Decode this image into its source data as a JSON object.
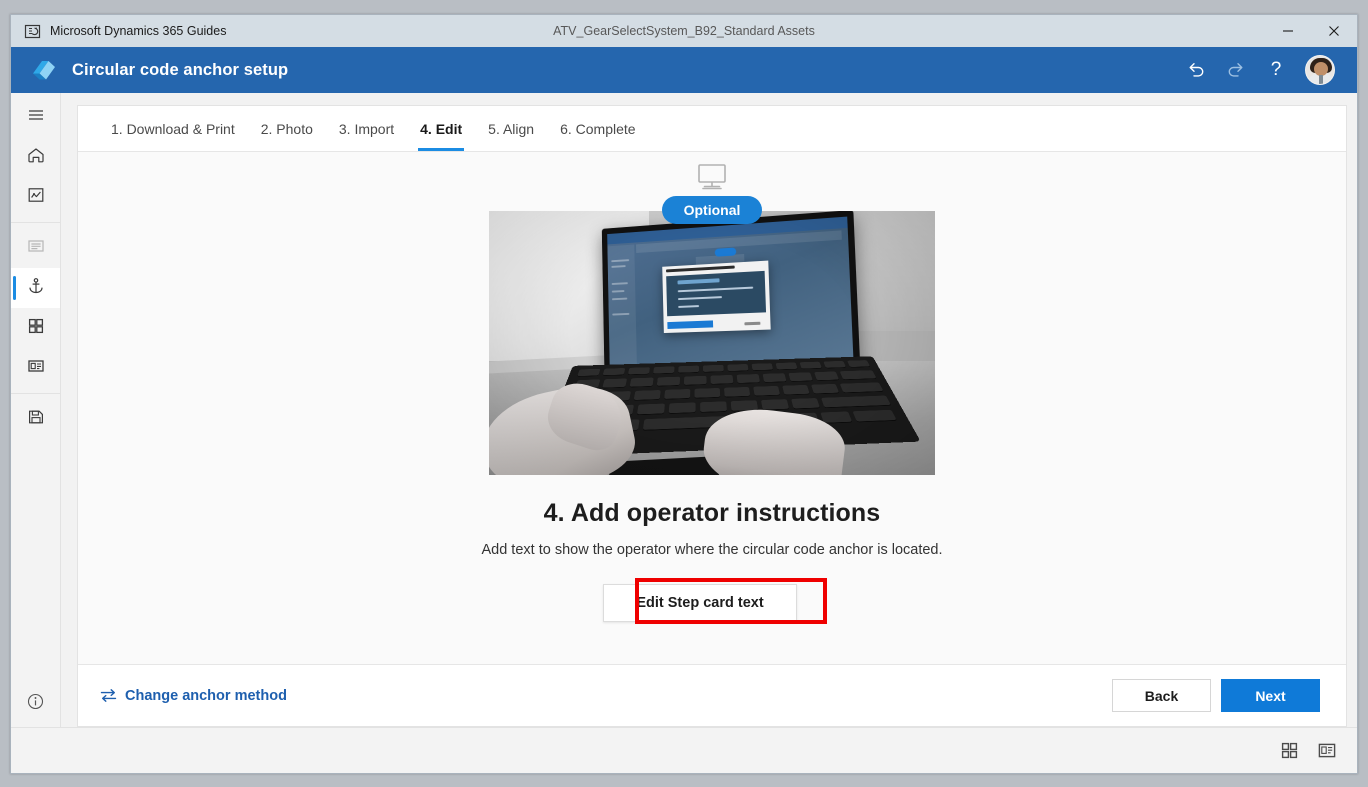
{
  "titlebar": {
    "app_icon": "dynamics-guides-icon",
    "app_name": "Microsoft Dynamics 365 Guides",
    "document_name": "ATV_GearSelectSystem_B92_Standard Assets",
    "minimize_label": "Minimize",
    "close_label": "Close"
  },
  "header": {
    "logo": "guides-cube-logo",
    "title": "Circular code anchor setup",
    "undo_label": "Undo",
    "redo_label": "Redo",
    "help_label": "?",
    "avatar_label": "User account",
    "accent_color": "#2566ae"
  },
  "sidebar": {
    "items": [
      {
        "name": "menu",
        "icon": "hamburger-menu-icon",
        "state": "normal"
      },
      {
        "name": "home",
        "icon": "home-icon",
        "state": "normal"
      },
      {
        "name": "analytics",
        "icon": "analytics-icon",
        "state": "normal"
      },
      {
        "name": "steps",
        "icon": "document-icon",
        "state": "dim"
      },
      {
        "name": "anchor",
        "icon": "anchor-icon",
        "state": "active"
      },
      {
        "name": "apps",
        "icon": "grid-icon",
        "state": "normal"
      },
      {
        "name": "step-card",
        "icon": "card-icon",
        "state": "normal"
      },
      {
        "name": "save",
        "icon": "save-icon",
        "state": "normal"
      }
    ],
    "info_icon": "info-circle-icon"
  },
  "tabs": [
    {
      "label": "1. Download & Print",
      "active": false
    },
    {
      "label": "2. Photo",
      "active": false
    },
    {
      "label": "3. Import",
      "active": false
    },
    {
      "label": "4. Edit",
      "active": true
    },
    {
      "label": "5. Align",
      "active": false
    },
    {
      "label": "6. Complete",
      "active": false
    }
  ],
  "main": {
    "device_icon": "desktop-monitor-icon",
    "badge": "Optional",
    "badge_color": "#1b82d6",
    "photo_alt": "Hands typing on a laptop showing the Guides PC app",
    "title": "4. Add operator instructions",
    "subtitle": "Add text to show the operator where the circular code anchor is located.",
    "cta_label": "Edit Step card text",
    "highlight_color": "#ef0000"
  },
  "footer": {
    "change_icon": "swap-arrows-icon",
    "change_label": "Change anchor method",
    "back_label": "Back",
    "next_label": "Next",
    "next_color": "#0f7ad8"
  },
  "statusbar": {
    "icons": [
      {
        "name": "grid-view-icon"
      },
      {
        "name": "card-view-icon"
      }
    ]
  }
}
